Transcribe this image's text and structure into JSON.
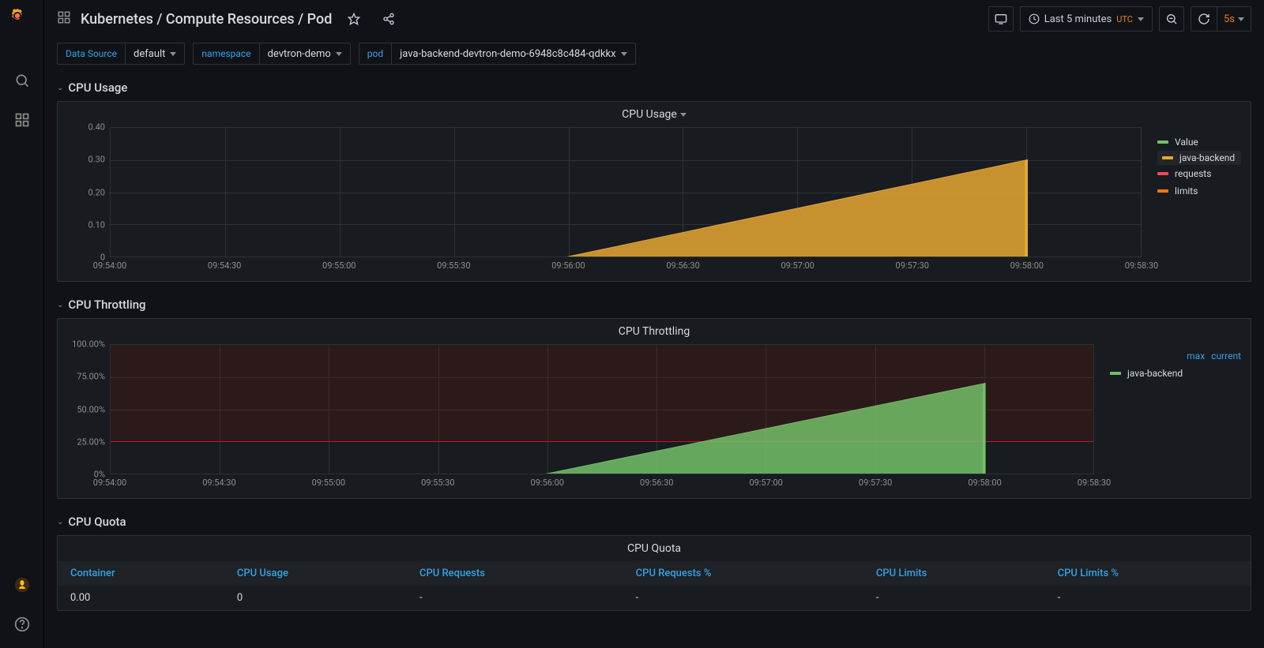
{
  "header": {
    "breadcrumb": "Kubernetes / Compute Resources / Pod",
    "time_range": "Last 5 minutes",
    "tz": "UTC",
    "refresh_interval": "5s"
  },
  "variables": {
    "datasource_label": "Data Source",
    "datasource_value": "default",
    "namespace_label": "namespace",
    "namespace_value": "devtron-demo",
    "pod_label": "pod",
    "pod_value": "java-backend-devtron-demo-6948c8c484-qdkkx"
  },
  "rows": {
    "cpu_usage": "CPU Usage",
    "cpu_throttling": "CPU Throttling",
    "cpu_quota": "CPU Quota"
  },
  "panels": {
    "cpu_usage": {
      "title": "CPU Usage",
      "legend": [
        "Value",
        "java-backend",
        "requests",
        "limits"
      ],
      "legend_colors": [
        "#73bf69",
        "#e5a631",
        "#f2495c",
        "#ff780a"
      ]
    },
    "cpu_throttling": {
      "title": "CPU Throttling",
      "legend_headers": [
        "max",
        "current"
      ],
      "legend": [
        "java-backend"
      ],
      "legend_colors": [
        "#73bf69"
      ]
    },
    "cpu_quota": {
      "title": "CPU Quota",
      "columns": [
        "Container",
        "CPU Usage",
        "CPU Requests",
        "CPU Requests %",
        "CPU Limits",
        "CPU Limits %"
      ],
      "rows": [
        [
          "0.00",
          "0",
          "-",
          "-",
          "-",
          "-"
        ]
      ]
    }
  },
  "chart_data": [
    {
      "id": "cpu_usage",
      "type": "area",
      "title": "CPU Usage",
      "ylabel": "",
      "ylim": [
        0,
        0.4
      ],
      "yticks": [
        "0",
        "0.10",
        "0.20",
        "0.30",
        "0.40"
      ],
      "x": [
        "09:54:00",
        "09:54:30",
        "09:55:00",
        "09:55:30",
        "09:56:00",
        "09:56:30",
        "09:57:00",
        "09:57:30",
        "09:58:00",
        "09:58:30"
      ],
      "series": [
        {
          "name": "java-backend",
          "color": "#e5a631",
          "values": [
            null,
            null,
            null,
            null,
            0.0,
            0.075,
            0.15,
            0.225,
            0.3,
            null
          ]
        }
      ]
    },
    {
      "id": "cpu_throttling",
      "type": "area",
      "title": "CPU Throttling",
      "ylabel": "",
      "ylim": [
        0,
        100
      ],
      "yticks": [
        "0%",
        "25.00%",
        "50.00%",
        "75.00%",
        "100.00%"
      ],
      "threshold_band": [
        25,
        100
      ],
      "threshold_line": 25,
      "x": [
        "09:54:00",
        "09:54:30",
        "09:55:00",
        "09:55:30",
        "09:56:00",
        "09:56:30",
        "09:57:00",
        "09:57:30",
        "09:58:00",
        "09:58:30"
      ],
      "series": [
        {
          "name": "java-backend",
          "color": "#73bf69",
          "values": [
            null,
            null,
            null,
            null,
            0,
            17.5,
            35,
            52.5,
            70,
            null
          ]
        }
      ]
    }
  ]
}
